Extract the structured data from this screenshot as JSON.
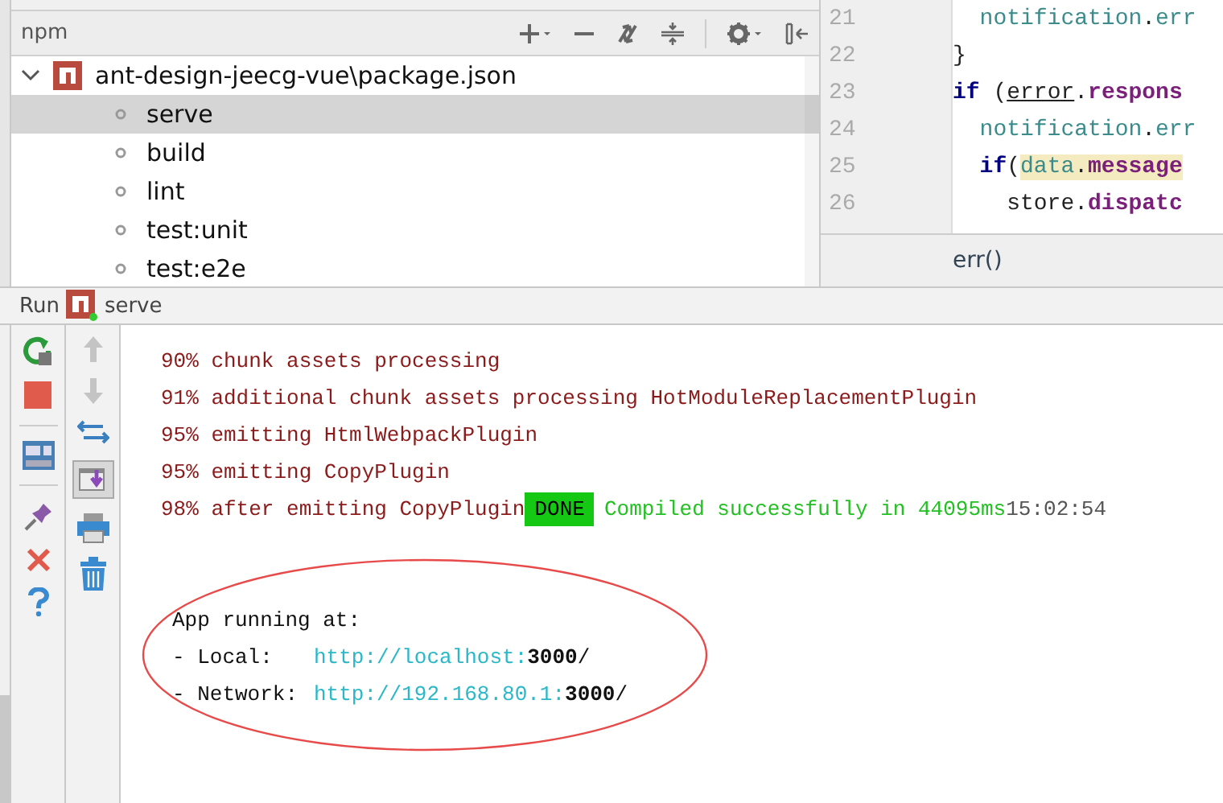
{
  "npm_panel": {
    "title": "npm",
    "tree": {
      "label": "ant-design-jeecg-vue\\package.json",
      "expanded": true,
      "children": [
        {
          "label": "serve",
          "selected": true
        },
        {
          "label": "build",
          "selected": false
        },
        {
          "label": "lint",
          "selected": false
        },
        {
          "label": "test:unit",
          "selected": false
        },
        {
          "label": "test:e2e",
          "selected": false
        }
      ]
    }
  },
  "editor": {
    "lines": [
      {
        "number": "21",
        "tokens": [
          {
            "kind": "ident",
            "text": "  notification"
          },
          {
            "kind": "punct",
            "text": "."
          },
          {
            "kind": "ident",
            "text": "err"
          }
        ]
      },
      {
        "number": "22",
        "tokens": [
          {
            "kind": "punct",
            "text": "}"
          }
        ]
      },
      {
        "number": "23",
        "tokens": [
          {
            "kind": "keyword",
            "text": "if"
          },
          {
            "kind": "punct",
            "text": " ("
          },
          {
            "kind": "underlined",
            "text": "error"
          },
          {
            "kind": "punct",
            "text": "."
          },
          {
            "kind": "prop",
            "text": "respons"
          }
        ]
      },
      {
        "number": "24",
        "tokens": [
          {
            "kind": "ident",
            "text": "  notification"
          },
          {
            "kind": "punct",
            "text": "."
          },
          {
            "kind": "ident",
            "text": "err"
          }
        ]
      },
      {
        "number": "25",
        "tokens": [
          {
            "kind": "keyword",
            "text": "  if"
          },
          {
            "kind": "punct",
            "text": "("
          },
          {
            "kind": "highlight-ident",
            "text": "data"
          },
          {
            "kind": "highlight-punct",
            "text": "."
          },
          {
            "kind": "highlight-prop",
            "text": "message"
          }
        ]
      },
      {
        "number": "26",
        "tokens": [
          {
            "kind": "plain",
            "text": "    store"
          },
          {
            "kind": "punct",
            "text": "."
          },
          {
            "kind": "prop",
            "text": "dispatc"
          }
        ]
      }
    ],
    "hint": "err()"
  },
  "run": {
    "title": "Run",
    "config": "serve",
    "console": [
      {
        "kind": "progress",
        "text": "90% chunk assets processing"
      },
      {
        "kind": "progress",
        "text": "91% additional chunk assets processing HotModuleReplacementPlugin"
      },
      {
        "kind": "progress",
        "text": "95% emitting HtmlWebpackPlugin"
      },
      {
        "kind": "progress",
        "text": "95% emitting CopyPlugin"
      },
      {
        "kind": "done",
        "text": "98% after emitting CopyPlugin",
        "badge": "DONE",
        "message": "Compiled successfully in 44095ms",
        "time": "15:02:54"
      }
    ],
    "app": {
      "heading": "App running at:",
      "urls": [
        {
          "label": "- Local:",
          "url": "http://localhost:",
          "port": "3000",
          "suffix": "/"
        },
        {
          "label": "- Network:",
          "url": "http://192.168.80.1:",
          "port": "3000",
          "suffix": "/"
        }
      ]
    }
  }
}
